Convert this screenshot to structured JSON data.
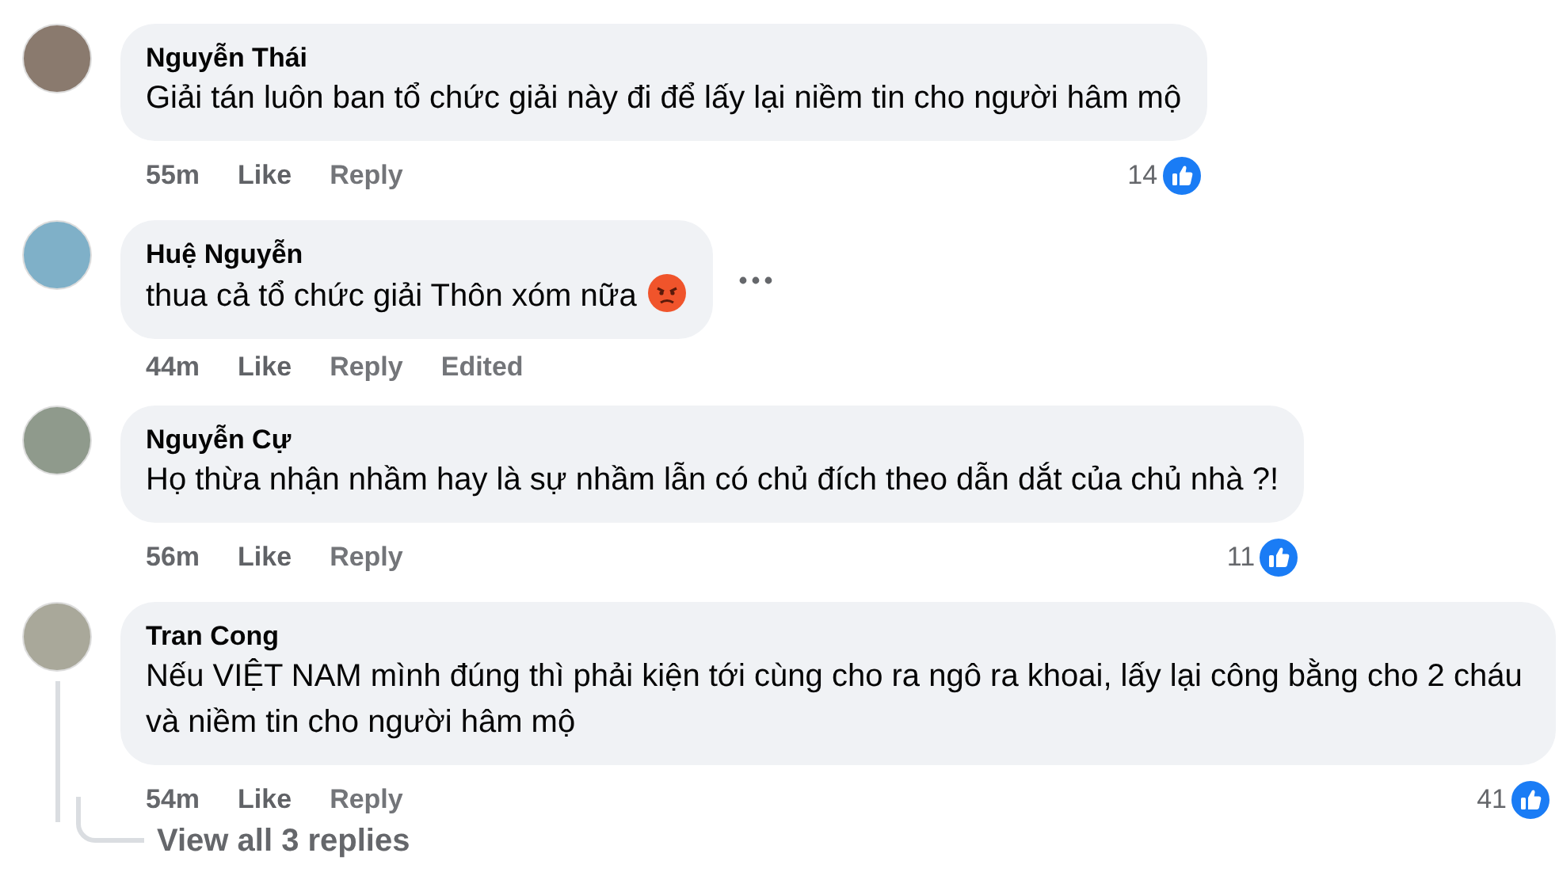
{
  "comments": [
    {
      "author": "Nguyễn Thái",
      "text": "Giải tán luôn ban tổ chức giải này đi để lấy lại niềm tin cho người hâm mộ",
      "time": "55m",
      "like": "Like",
      "reply": "Reply",
      "reactions": "14",
      "has_menu": false
    },
    {
      "author": "Huệ Nguyễn",
      "text": "thua cả tổ chức giải Thôn xóm nữa",
      "angry_emoji": true,
      "time": "44m",
      "like": "Like",
      "reply": "Reply",
      "edited": "Edited",
      "has_menu": true
    },
    {
      "author": "Nguyễn Cự",
      "text": "Họ thừa nhận nhầm hay là sự nhầm lẫn có chủ đích theo dẫn dắt của chủ nhà ?!",
      "time": "56m",
      "like": "Like",
      "reply": "Reply",
      "reactions": "11",
      "has_menu": false
    },
    {
      "author": "Tran Cong",
      "text": "Nếu VIỆT NAM mình đúng thì phải kiện tới cùng cho ra ngô ra khoai, lấy lại công bằng cho 2 cháu và niềm tin cho người hâm mộ",
      "time": "54m",
      "like": "Like",
      "reply": "Reply",
      "reactions": "41",
      "has_menu": false,
      "view_replies": "View all 3 replies"
    }
  ]
}
